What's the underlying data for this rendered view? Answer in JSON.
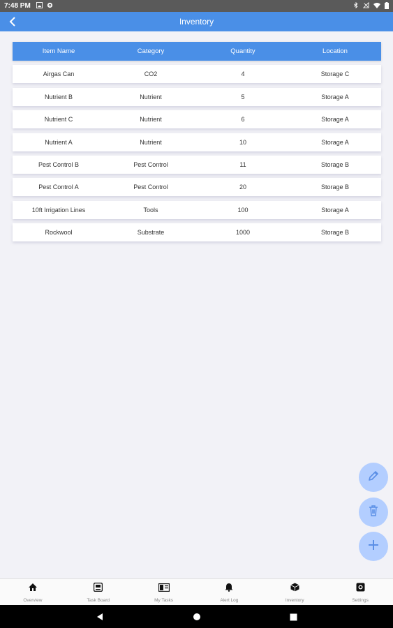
{
  "status_bar": {
    "time": "7:48 PM"
  },
  "app_bar": {
    "title": "Inventory"
  },
  "table": {
    "headers": [
      "Item Name",
      "Category",
      "Quantity",
      "Location"
    ],
    "rows": [
      [
        "Airgas Can",
        "CO2",
        "4",
        "Storage C"
      ],
      [
        "Nutrient B",
        "Nutrient",
        "5",
        "Storage A"
      ],
      [
        "Nutrient C",
        "Nutrient",
        "6",
        "Storage A"
      ],
      [
        "Nutrient A",
        "Nutrient",
        "10",
        "Storage A"
      ],
      [
        "Pest Control B",
        "Pest Control",
        "11",
        "Storage B"
      ],
      [
        "Pest Control A",
        "Pest Control",
        "20",
        "Storage B"
      ],
      [
        "10ft Irrigation Lines",
        "Tools",
        "100",
        "Storage A"
      ],
      [
        "Rockwool",
        "Substrate",
        "1000",
        "Storage B"
      ]
    ]
  },
  "fabs": [
    {
      "name": "edit",
      "icon": "pencil-icon"
    },
    {
      "name": "delete",
      "icon": "trash-icon"
    },
    {
      "name": "add",
      "icon": "plus-icon"
    }
  ],
  "bottom_nav": [
    {
      "label": "Overview",
      "icon": "home-icon"
    },
    {
      "label": "Task Board",
      "icon": "board-icon"
    },
    {
      "label": "My Tasks",
      "icon": "tasks-icon"
    },
    {
      "label": "Alert Log",
      "icon": "bell-icon"
    },
    {
      "label": "Inventory",
      "icon": "box-icon"
    },
    {
      "label": "Settings",
      "icon": "gear-icon"
    }
  ],
  "colors": {
    "accent": "#4a8fe7",
    "fab": "#b3ceff",
    "fab_icon": "#5b8fe6",
    "background": "#f2f2f7"
  }
}
